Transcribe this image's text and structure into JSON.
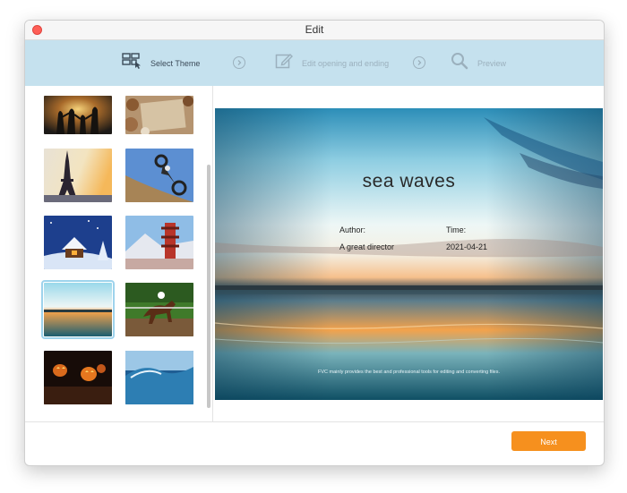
{
  "window": {
    "title": "Edit"
  },
  "steps": [
    {
      "label": "Select Theme",
      "icon": "grid-select-icon",
      "active": true
    },
    {
      "label": "Edit opening and ending",
      "icon": "edit-icon",
      "active": false
    },
    {
      "label": "Preview",
      "icon": "search-icon",
      "active": false
    }
  ],
  "themes": [
    {
      "name": "family-sunset",
      "selected": false
    },
    {
      "name": "paper-note",
      "selected": false
    },
    {
      "name": "eiffel-tower",
      "selected": false
    },
    {
      "name": "motocross",
      "selected": false
    },
    {
      "name": "snow-cabin",
      "selected": false
    },
    {
      "name": "pagoda-mountain",
      "selected": false
    },
    {
      "name": "sea-waves",
      "selected": true
    },
    {
      "name": "horse-race",
      "selected": false
    },
    {
      "name": "halloween-pumpkins",
      "selected": false
    },
    {
      "name": "ocean-wave",
      "selected": false
    }
  ],
  "preview": {
    "title": "sea waves",
    "author_label": "Author:",
    "author_value": "A great director",
    "time_label": "Time:",
    "time_value": "2021-04-21",
    "footer": "FVC mainly provides the best and professional tools for editing and converting files."
  },
  "actions": {
    "next_label": "Next"
  },
  "colors": {
    "accent": "#f6901e",
    "stepbar": "#c5e1ee",
    "selection": "#9ed3ec"
  }
}
